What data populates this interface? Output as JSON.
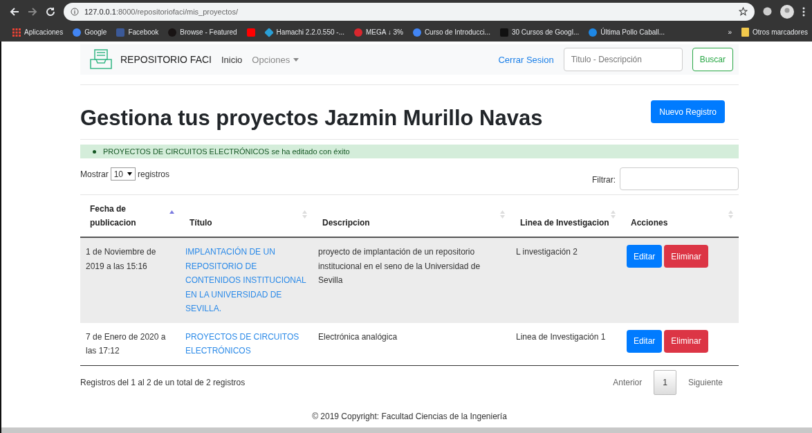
{
  "browser": {
    "url_host": "127.0.0.1",
    "url_path": ":8000/repositoriofaci/mis_proyectos/",
    "bookmarks": [
      {
        "label": "Aplicaciones",
        "kind": "apps",
        "color": "#e94235"
      },
      {
        "label": "Google",
        "kind": "g",
        "color": "#4285f4"
      },
      {
        "label": "Facebook",
        "kind": "square",
        "color": "#3b5998"
      },
      {
        "label": "Browse - Featured",
        "kind": "circle",
        "color": "#191414"
      },
      {
        "kind": "square",
        "color": "#ff0000"
      },
      {
        "label": "Hamachi 2.2.0.550 -...",
        "kind": "diamond",
        "color": "#2a9fd6"
      },
      {
        "label": "MEGA ↓ 3%",
        "kind": "circle",
        "color": "#d9272e"
      },
      {
        "label": "Curso de Introducci...",
        "kind": "g",
        "color": "#4285f4"
      },
      {
        "label": "30 Cursos de Googl...",
        "kind": "square",
        "color": "#111111"
      },
      {
        "label": "Última Pollo Caball...",
        "kind": "circle",
        "color": "#1e88e5"
      }
    ],
    "overflow": "»",
    "other": "Otros marcadores"
  },
  "navbar": {
    "brand": "REPOSITORIO FACI",
    "links": [
      {
        "label": "Inicio",
        "selected": true
      },
      {
        "label": "Opciones",
        "selected": false
      }
    ],
    "logout": "Cerrar Sesion",
    "search_placeholder": "Titulo - Descripción",
    "search_button": "Buscar"
  },
  "heading": "Gestiona tus proyectos Jazmin Murillo Navas",
  "new_button": "Nuevo Registro",
  "alert": "PROYECTOS DE CIRCUITOS ELECTRÓNICOS se ha editado con éxito",
  "length": {
    "before": "Mostrar",
    "value": "10",
    "after": "registros"
  },
  "filter_label": "Filtrar:",
  "table": {
    "columns": [
      {
        "label": "Fecha de publicacion",
        "sorted": true
      },
      {
        "label": "Título",
        "sorted": false
      },
      {
        "label": "Descripcion",
        "sorted": false
      },
      {
        "label": "Linea de Investigacion",
        "sorted": false
      },
      {
        "label": "Acciones",
        "sorted": false
      }
    ],
    "rows": [
      {
        "fecha": "1 de Noviembre de 2019 a las 15:16",
        "titulo": "IMPLANTACIÓN DE UN REPOSITORIO DE CONTENIDOS INSTITUCIONAL EN LA UNIVERSIDAD DE SEVILLA.",
        "descripcion": "proyecto de implantación de un repositorio institucional en el seno de la Universidad de Sevilla",
        "linea": "L investigación 2",
        "selected": true,
        "edit": "Editar",
        "delete": "Eliminar"
      },
      {
        "fecha": "7 de Enero de 2020 a las 17:12",
        "titulo": "PROYECTOS DE CIRCUITOS ELECTRÓNICOS",
        "descripcion": "Electrónica analógica",
        "linea": "Linea de Investigación 1",
        "selected": false,
        "edit": "Editar",
        "delete": "Eliminar"
      }
    ]
  },
  "info": "Registros del 1 al 2 de un total de 2 registros",
  "pagination": [
    {
      "label": "Anterior",
      "selected": false
    },
    {
      "label": "1",
      "selected": true
    },
    {
      "label": "Siguiente",
      "selected": false
    }
  ],
  "footer": "© 2019 Copyright: Facultad Ciencias de la Ingeniería"
}
